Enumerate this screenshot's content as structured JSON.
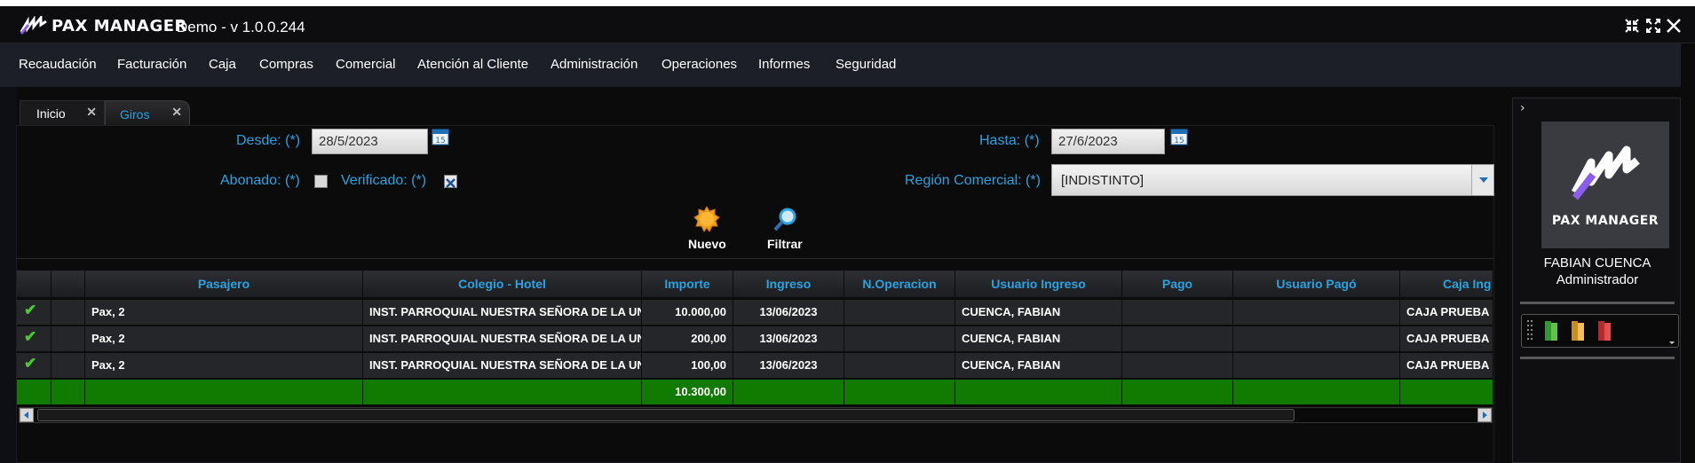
{
  "app": {
    "logo_text": "PAX MANAGER",
    "title": "Demo - v 1.0.0.244",
    "controls": [
      "minimize-icon",
      "maximize-icon",
      "close-icon"
    ]
  },
  "menu": [
    "Recaudación",
    "Facturación",
    "Caja",
    "Compras",
    "Comercial",
    "Atención al Cliente",
    "Administración",
    "Operaciones",
    "Informes",
    "Seguridad"
  ],
  "tabs": [
    {
      "label": "Inicio",
      "active": false
    },
    {
      "label": "Giros",
      "active": true
    }
  ],
  "filters": {
    "desde_label": "Desde: (*)",
    "desde_value": "28/5/2023",
    "hasta_label": "Hasta: (*)",
    "hasta_value": "27/6/2023",
    "abonado_label": "Abonado: (*)",
    "abonado_checked": false,
    "verificado_label": "Verificado: (*)",
    "verificado_checked": true,
    "region_label": "Región Comercial: (*)",
    "region_value": "[INDISTINTO]",
    "calendar_day": "15"
  },
  "actions": {
    "nuevo": "Nuevo",
    "filtrar": "Filtrar"
  },
  "grid": {
    "columns": [
      "",
      "",
      "Pasajero",
      "Colegio - Hotel",
      "Importe",
      "Ingreso",
      "N.Operacion",
      "Usuario Ingreso",
      "Pago",
      "Usuario Pagó",
      "Caja Ing"
    ],
    "rows": [
      {
        "pasajero": "Pax, 2",
        "colegio": "INST. PARROQUIAL NUESTRA SEÑORA DE LA UN",
        "importe": "10.000,00",
        "ingreso": "13/06/2023",
        "noperacion": "",
        "usuario_ingreso": "CUENCA, FABIAN",
        "pago": "",
        "usuario_pago": "",
        "caja": "CAJA PRUEBA"
      },
      {
        "pasajero": "Pax, 2",
        "colegio": "INST. PARROQUIAL NUESTRA SEÑORA DE LA UN",
        "importe": "200,00",
        "ingreso": "13/06/2023",
        "noperacion": "",
        "usuario_ingreso": "CUENCA, FABIAN",
        "pago": "",
        "usuario_pago": "",
        "caja": "CAJA PRUEBA"
      },
      {
        "pasajero": "Pax, 2",
        "colegio": "INST. PARROQUIAL NUESTRA SEÑORA DE LA UN",
        "importe": "100,00",
        "ingreso": "13/06/2023",
        "noperacion": "",
        "usuario_ingreso": "CUENCA, FABIAN",
        "pago": "",
        "usuario_pago": "",
        "caja": "CAJA PRUEBA"
      }
    ],
    "total_importe": "10.300,00"
  },
  "sidebar": {
    "logo_text": "PAX MANAGER",
    "user_name": "FABIAN CUENCA",
    "user_role": "Administrador"
  },
  "colors": {
    "accent": "#2aa3e0",
    "total_row": "#117a00",
    "check": "#4ecb2c"
  }
}
